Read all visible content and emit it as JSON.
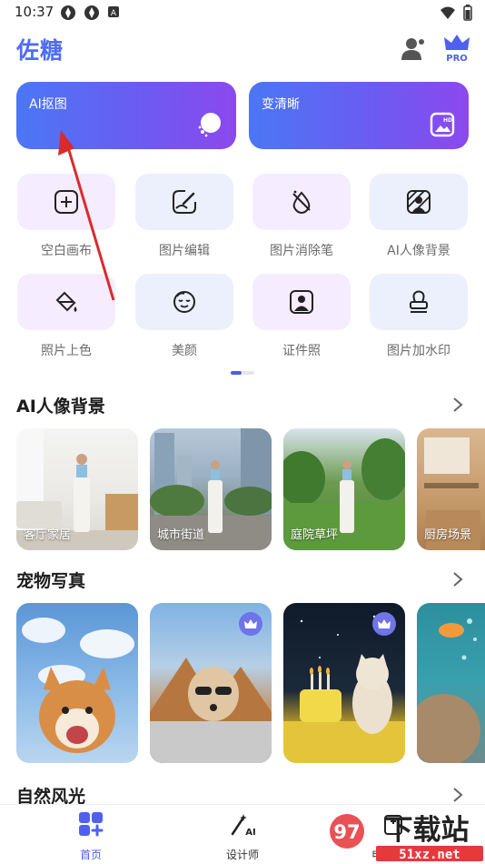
{
  "status_bar": {
    "time": "10:37"
  },
  "header": {
    "title": "佐糖",
    "pro_label": "PRO"
  },
  "hero": [
    {
      "label": "AI抠图",
      "icon": "cutout-icon"
    },
    {
      "label": "变清晰",
      "icon": "hd-image-icon"
    }
  ],
  "tools": [
    {
      "label": "空白画布",
      "icon": "plus-square-icon"
    },
    {
      "label": "图片编辑",
      "icon": "edit-image-icon"
    },
    {
      "label": "图片消除笔",
      "icon": "eraser-drop-icon"
    },
    {
      "label": "AI人像背景",
      "icon": "portrait-background-icon"
    },
    {
      "label": "照片上色",
      "icon": "paint-bucket-icon"
    },
    {
      "label": "美颜",
      "icon": "face-beauty-icon"
    },
    {
      "label": "证件照",
      "icon": "id-photo-icon"
    },
    {
      "label": "图片加水印",
      "icon": "stamp-icon"
    }
  ],
  "sections": [
    {
      "title": "AI人像背景",
      "cards": [
        {
          "caption": "客厅家居"
        },
        {
          "caption": "城市街道"
        },
        {
          "caption": "庭院草坪"
        },
        {
          "caption": "厨房场景"
        }
      ]
    },
    {
      "title": "宠物写真"
    },
    {
      "title": "自然风光"
    }
  ],
  "bottom_nav": [
    {
      "label": "首页",
      "icon": "home-grid-icon",
      "active": true
    },
    {
      "label": "设计师",
      "icon": "ai-design-icon",
      "active": false
    },
    {
      "label": "电商设计",
      "icon": "ecommerce-icon",
      "active": false
    }
  ],
  "watermark": {
    "brand": "下载站",
    "domain": "51xz.net"
  },
  "colors": {
    "accent": "#4e6cf6",
    "hero_gradient_start": "#4b77f4",
    "hero_gradient_end": "#8c48ee",
    "annotation_arrow": "#d92b2b"
  }
}
